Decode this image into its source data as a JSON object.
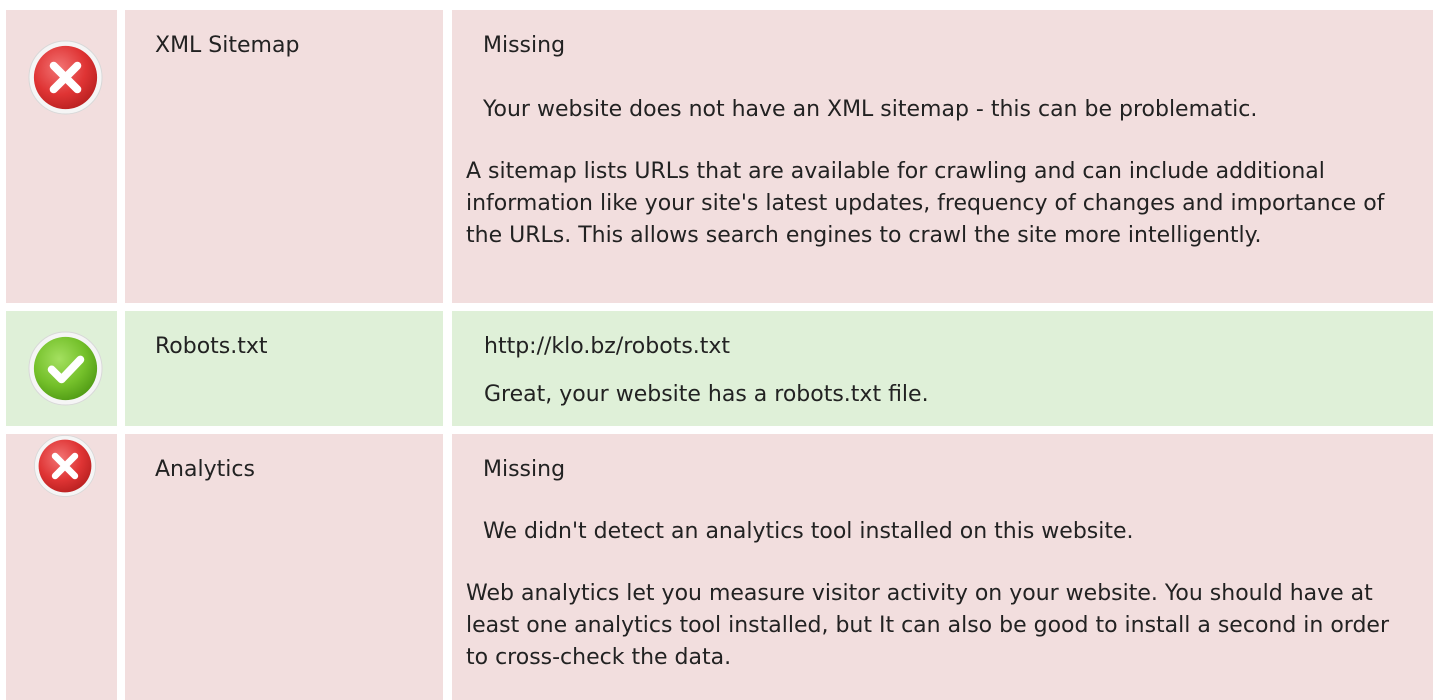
{
  "checks": [
    {
      "status": "fail",
      "icon": "error-icon",
      "label": "XML Sitemap",
      "value": "Missing",
      "summary": "Your website does not have an XML sitemap - this can be problematic.",
      "explanation": "A sitemap lists URLs that are available for crawling and can include additional information like your site's latest updates, frequency of changes and importance of the URLs. This allows search engines to crawl the site more intelligently."
    },
    {
      "status": "pass",
      "icon": "success-icon",
      "label": "Robots.txt",
      "value": "http://klo.bz/robots.txt",
      "summary": "Great, your website has a robots.txt file."
    },
    {
      "status": "fail",
      "icon": "error-icon",
      "label": "Analytics",
      "value": "Missing",
      "summary": "We didn't detect an analytics tool installed on this website.",
      "explanation": "Web analytics let you measure visitor activity on your website. You should have at least one analytics tool installed, but It can also be good to install a second in order to cross-check the data."
    }
  ],
  "colors": {
    "fail_background": "#f2dede",
    "pass_background": "#dff0d8",
    "error_icon": "#e13a3a",
    "success_icon": "#79c62d"
  }
}
